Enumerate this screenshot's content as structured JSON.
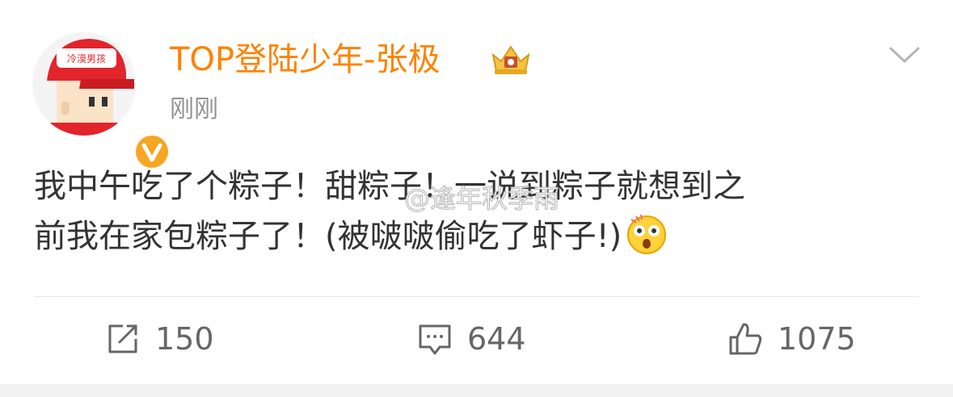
{
  "post": {
    "username": "TOP登陆少年-张极",
    "time": "刚刚",
    "avatar_text": "冷漠男孩",
    "content_lines": [
      "我中午吃了个粽子！甜粽子！一说到粽子就想到之",
      "前我在家包粽子了！(被啵啵偷吃了虾子!)"
    ],
    "watermark": "@逢年秋季雨",
    "emoji": "astonished-emoji"
  },
  "actions": {
    "repost_count": "150",
    "comment_count": "644",
    "like_count": "1075"
  },
  "colors": {
    "username": "#ff8200",
    "verified_badge": "#f5a623",
    "text": "#333333",
    "muted": "#939393"
  }
}
